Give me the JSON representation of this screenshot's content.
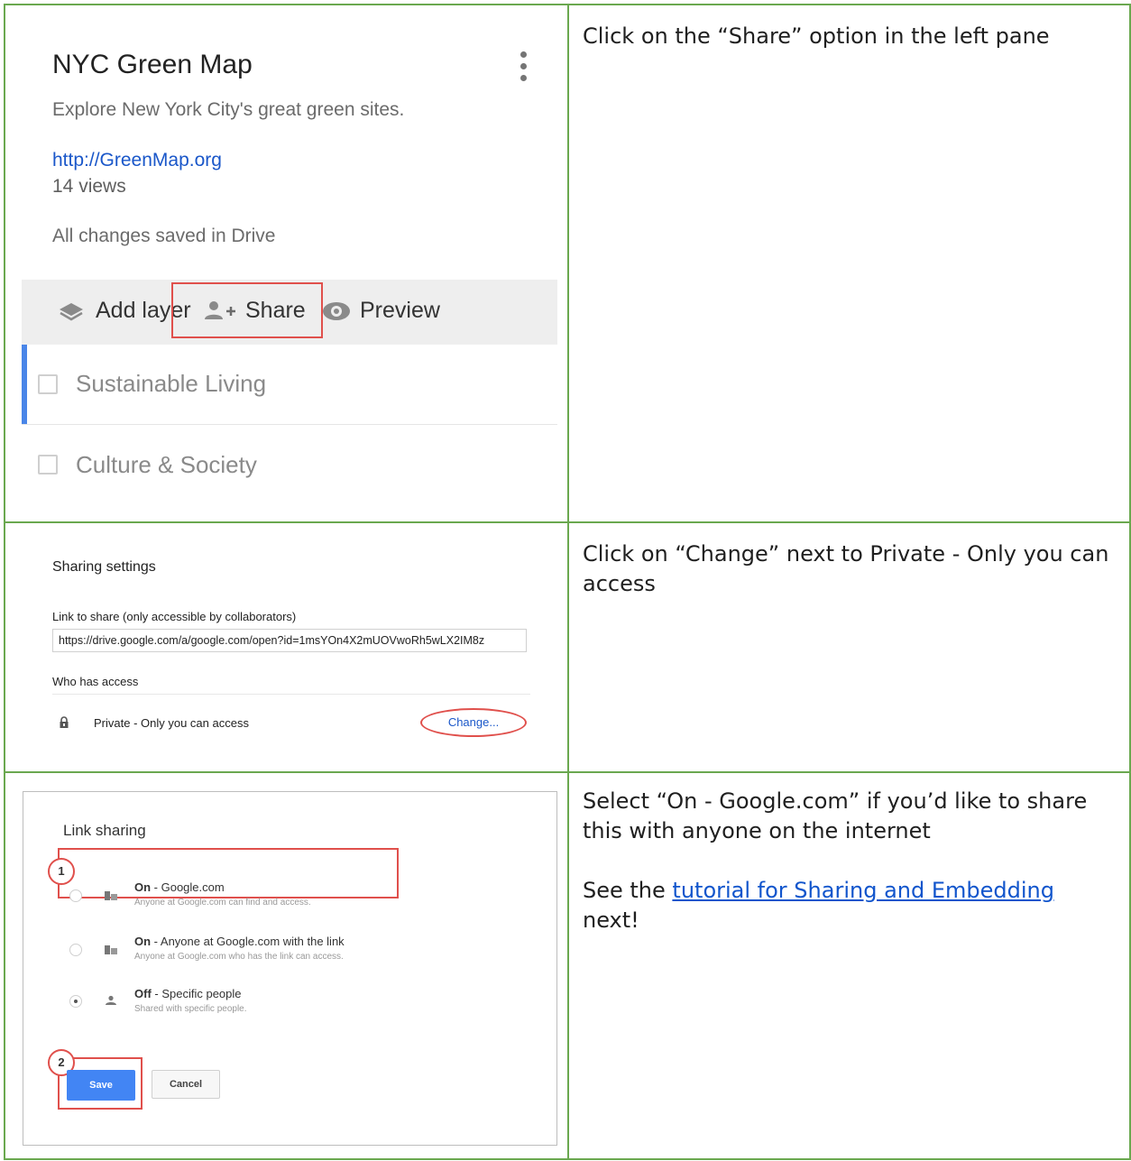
{
  "steps": [
    {
      "panel": {
        "map_title": "NYC Green Map",
        "description": "Explore New York City's great green sites.",
        "link": "http://GreenMap.org",
        "views": "14 views",
        "save_status": "All changes saved in Drive",
        "toolbar": {
          "add_layer": "Add layer",
          "share": "Share",
          "preview": "Preview"
        },
        "layers": [
          {
            "label": "Sustainable Living"
          },
          {
            "label": "Culture & Society"
          }
        ],
        "accent_color": "#4a86e8"
      },
      "instruction": "Click on the “Share” option in the left pane"
    },
    {
      "panel": {
        "title": "Sharing settings",
        "link_label": "Link to share (only accessible by collaborators)",
        "link_url": "https://drive.google.com/a/google.com/open?id=1msYOn4X2mUOVwoRh5wLX2IM8z",
        "who_has_access": "Who has access",
        "access_status": "Private - Only you can access",
        "change_link": "Change..."
      },
      "instruction": "Click on “Change” next to Private - Only you can access"
    },
    {
      "panel": {
        "title": "Link sharing",
        "badge_1": "1",
        "badge_2": "2",
        "options": [
          {
            "label_bold": "On",
            "label_rest": " - Google.com",
            "sub": "Anyone at Google.com can find and access.",
            "selected": false
          },
          {
            "label_bold": "On",
            "label_rest": " - Anyone at Google.com with the link",
            "sub": "Anyone at Google.com who has the link can access.",
            "selected": false
          },
          {
            "label_bold": "Off",
            "label_rest": " - Specific people",
            "sub": "Shared with specific people.",
            "selected": true
          }
        ],
        "save_label": "Save",
        "cancel_label": "Cancel",
        "save_color": "#4285f4",
        "highlight_color": "#e0504c"
      },
      "instruction": "Select “On - Google.com” if you’d like to share this with anyone on the internet",
      "see_prefix": "See the ",
      "tutorial_link": "tutorial for Sharing and Embedding",
      "see_suffix": "next!"
    }
  ],
  "border_color": "#6aa84f"
}
